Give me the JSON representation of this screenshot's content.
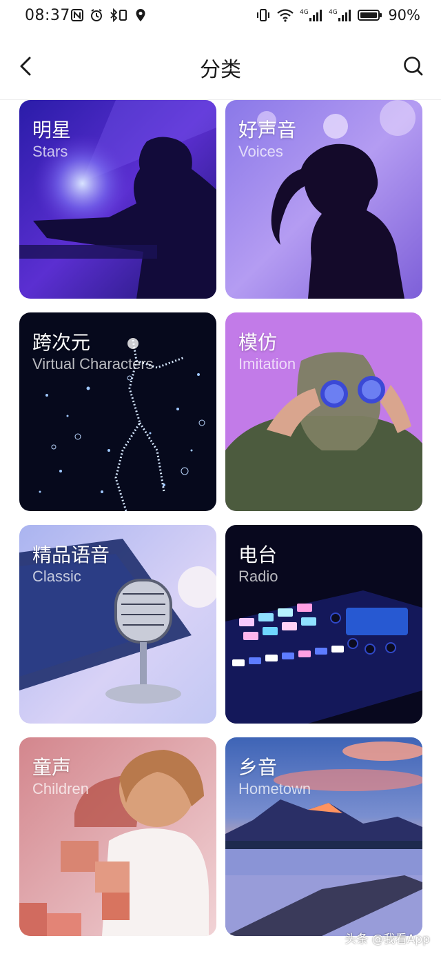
{
  "status_bar": {
    "time": "08:37",
    "battery_percent": "90%",
    "network_1": "4G",
    "network_2": "4G"
  },
  "header": {
    "title": "分类",
    "back_icon": "chevron-left-icon",
    "search_icon": "search-icon"
  },
  "categories": [
    {
      "cn": "明星",
      "en": "Stars"
    },
    {
      "cn": "好声音",
      "en": "Voices"
    },
    {
      "cn": "跨次元",
      "en": "Virtual Characters"
    },
    {
      "cn": "模仿",
      "en": "Imitation"
    },
    {
      "cn": "精品语音",
      "en": "Classic"
    },
    {
      "cn": "电台",
      "en": "Radio"
    },
    {
      "cn": "童声",
      "en": "Children"
    },
    {
      "cn": "乡音",
      "en": "Hometown"
    }
  ],
  "watermark": "头条 @我看App"
}
